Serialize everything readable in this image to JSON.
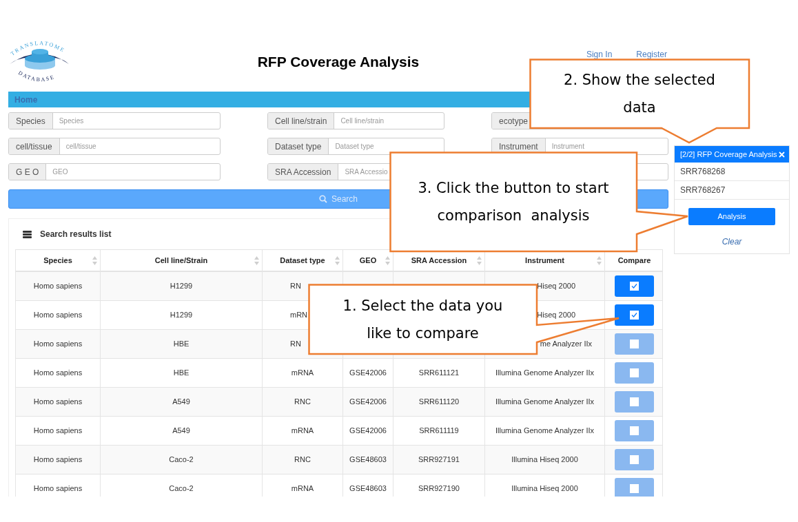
{
  "header": {
    "logo_top": "TRANSLATOME",
    "logo_bottom": "DATABASE",
    "title": "RFP Coverage Analysis",
    "links": [
      "Sign In",
      "Register"
    ]
  },
  "nav": {
    "items": [
      {
        "label": "Home",
        "selected": true
      }
    ]
  },
  "filters": [
    {
      "kind": "labeled",
      "label": "Species",
      "placeholder": "Species"
    },
    {
      "kind": "labeled",
      "label": "Cell line/strain",
      "placeholder": "Cell line/strain"
    },
    {
      "kind": "labeled",
      "label": "ecotype"
    },
    {
      "kind": "labeled",
      "label": "cell/tissue",
      "placeholder": "cell/tissue"
    },
    {
      "kind": "labeled",
      "label": "Dataset type",
      "placeholder": "Dataset type"
    },
    {
      "kind": "labeled",
      "label": "Instrument",
      "placeholder": "Instrument"
    },
    {
      "kind": "labeled",
      "label": "G E O",
      "placeholder": "GEO"
    },
    {
      "kind": "labeled",
      "label": "SRA Accession",
      "placeholder": "SRA Accessio"
    },
    {
      "kind": "plain"
    }
  ],
  "search_button": {
    "label": "Search"
  },
  "results": {
    "title": "Search results list",
    "columns": [
      {
        "label": "Species",
        "sortable": true
      },
      {
        "label": "Cell line/Strain",
        "sortable": true
      },
      {
        "label": "Dataset type",
        "sortable": true
      },
      {
        "label": "GEO",
        "sortable": true
      },
      {
        "label": "SRA Accession",
        "sortable": true
      },
      {
        "label": "Instrument",
        "sortable": true
      },
      {
        "label": "Compare",
        "sortable": false
      }
    ],
    "rows": [
      {
        "cells": [
          "Homo sapiens",
          "H1299",
          "RN",
          "",
          "",
          "Hiseq 2000"
        ],
        "checked": true
      },
      {
        "cells": [
          "Homo sapiens",
          "H1299",
          "mRN",
          "",
          "",
          "Hiseq 2000"
        ],
        "checked": true
      },
      {
        "cells": [
          "Homo sapiens",
          "HBE",
          "RN",
          "",
          "",
          "me Analyzer IIx"
        ],
        "checked": false
      },
      {
        "cells": [
          "Homo sapiens",
          "HBE",
          "mRNA",
          "GSE42006",
          "SRR611121",
          "Illumina Genome Analyzer IIx"
        ],
        "checked": false
      },
      {
        "cells": [
          "Homo sapiens",
          "A549",
          "RNC",
          "GSE42006",
          "SRR611120",
          "Illumina Genome Analyzer IIx"
        ],
        "checked": false
      },
      {
        "cells": [
          "Homo sapiens",
          "A549",
          "mRNA",
          "GSE42006",
          "SRR611119",
          "Illumina Genome Analyzer IIx"
        ],
        "checked": false
      },
      {
        "cells": [
          "Homo sapiens",
          "Caco-2",
          "RNC",
          "GSE48603",
          "SRR927191",
          "Illumina Hiseq 2000"
        ],
        "checked": false
      },
      {
        "cells": [
          "Homo sapiens",
          "Caco-2",
          "mRNA",
          "GSE48603",
          "SRR927190",
          "Illumina Hiseq 2000"
        ],
        "checked": false
      }
    ]
  },
  "selection_panel": {
    "title": "[2/2] RFP Coverage Analysis",
    "items": [
      "SRR768268",
      "SRR768267"
    ],
    "button": "Analysis",
    "link": "Clear"
  },
  "callouts": [
    {
      "lines": [
        "1. Select the data you",
        "like to compare"
      ]
    },
    {
      "lines": [
        "2. Show the selected",
        "data"
      ]
    },
    {
      "lines": [
        "3. Click the button to start",
        "comparison  analysis"
      ]
    }
  ]
}
